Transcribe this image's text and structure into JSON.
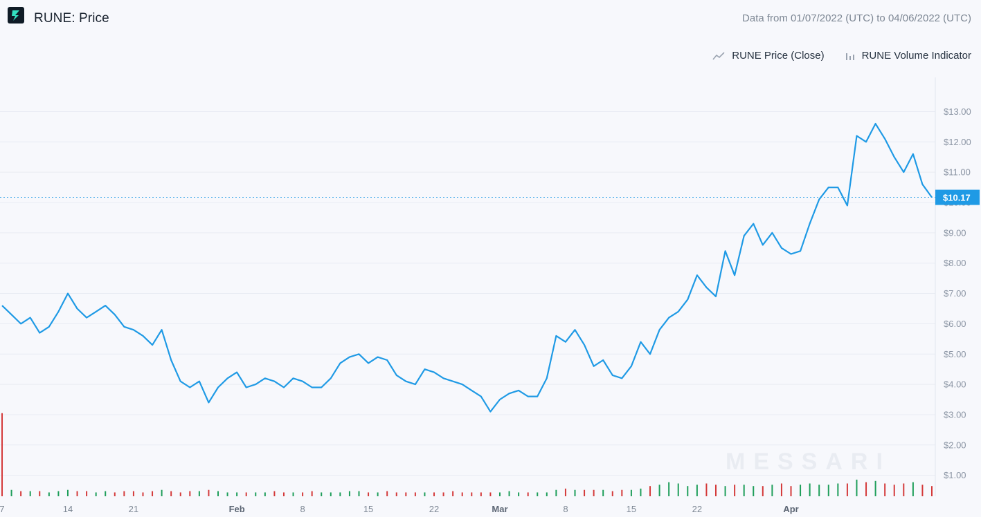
{
  "header": {
    "title": "RUNE: Price",
    "date_range": "Data from 01/07/2022 (UTC) to 04/06/2022 (UTC)",
    "logo_icon": "thorchain-logo-icon"
  },
  "legend": [
    {
      "label": "RUNE Price (Close)",
      "icon": "line-series-icon"
    },
    {
      "label": "RUNE Volume Indicator",
      "icon": "bar-series-icon"
    }
  ],
  "watermark": "MESSARI",
  "colors": {
    "line": "#1f9ae5",
    "last_price_badge": "#1f9ae5",
    "volume_up": "#1e9e5a",
    "volume_down": "#d43a3a",
    "grid": "#e8ebf3",
    "background": "#f7f8fc"
  },
  "chart_data": {
    "type": "line",
    "title": "RUNE: Price",
    "xlabel": "",
    "ylabel": "",
    "ylim": [
      0.3,
      13.5
    ],
    "last_value_label": "$10.17",
    "y_ticks": [
      {
        "value": 1,
        "label": "$1.00"
      },
      {
        "value": 2,
        "label": "$2.00"
      },
      {
        "value": 3,
        "label": "$3.00"
      },
      {
        "value": 4,
        "label": "$4.00"
      },
      {
        "value": 5,
        "label": "$5.00"
      },
      {
        "value": 6,
        "label": "$6.00"
      },
      {
        "value": 7,
        "label": "$7.00"
      },
      {
        "value": 8,
        "label": "$8.00"
      },
      {
        "value": 9,
        "label": "$9.00"
      },
      {
        "value": 10,
        "label": "$10.00"
      },
      {
        "value": 11,
        "label": "$11.00"
      },
      {
        "value": 12,
        "label": "$12.00"
      },
      {
        "value": 13,
        "label": "$13.00"
      }
    ],
    "x_ticks": [
      {
        "day": 0,
        "label": "7"
      },
      {
        "day": 7,
        "label": "14"
      },
      {
        "day": 14,
        "label": "21"
      },
      {
        "day": 25,
        "label": "Feb",
        "month": true
      },
      {
        "day": 32,
        "label": "8"
      },
      {
        "day": 39,
        "label": "15"
      },
      {
        "day": 46,
        "label": "22"
      },
      {
        "day": 53,
        "label": "Mar",
        "month": true
      },
      {
        "day": 60,
        "label": "8"
      },
      {
        "day": 67,
        "label": "15"
      },
      {
        "day": 74,
        "label": "22"
      },
      {
        "day": 84,
        "label": "Apr",
        "month": true
      }
    ],
    "series": [
      {
        "name": "RUNE Price (Close)",
        "x_start": "2022-01-07",
        "values": [
          6.6,
          6.3,
          6.0,
          6.2,
          5.7,
          5.9,
          6.4,
          7.0,
          6.5,
          6.2,
          6.4,
          6.6,
          6.3,
          5.9,
          5.8,
          5.6,
          5.3,
          5.8,
          4.8,
          4.1,
          3.9,
          4.1,
          3.4,
          3.9,
          4.2,
          4.4,
          3.9,
          4.0,
          4.2,
          4.1,
          3.9,
          4.2,
          4.1,
          3.9,
          3.9,
          4.2,
          4.7,
          4.9,
          5.0,
          4.7,
          4.9,
          4.8,
          4.3,
          4.1,
          4.0,
          4.5,
          4.4,
          4.2,
          4.1,
          4.0,
          3.8,
          3.6,
          3.1,
          3.5,
          3.7,
          3.8,
          3.6,
          3.6,
          4.2,
          5.6,
          5.4,
          5.8,
          5.3,
          4.6,
          4.8,
          4.3,
          4.2,
          4.6,
          5.4,
          5.0,
          5.8,
          6.2,
          6.4,
          6.8,
          7.6,
          7.2,
          6.9,
          8.4,
          7.6,
          8.9,
          9.3,
          8.6,
          9.0,
          8.5,
          8.3,
          8.4,
          9.3,
          10.1,
          10.5,
          10.5,
          9.9,
          12.2,
          12.0,
          12.6,
          12.1,
          11.5,
          11.0,
          11.6,
          10.6,
          10.17
        ]
      },
      {
        "name": "RUNE Volume Indicator",
        "values": [
          0.65,
          0.05,
          0.04,
          0.04,
          0.04,
          0.03,
          0.04,
          0.05,
          0.04,
          0.04,
          0.03,
          0.04,
          0.03,
          0.04,
          0.04,
          0.03,
          0.04,
          0.05,
          0.04,
          0.03,
          0.04,
          0.04,
          0.05,
          0.04,
          0.03,
          0.03,
          0.03,
          0.03,
          0.03,
          0.04,
          0.03,
          0.03,
          0.03,
          0.04,
          0.03,
          0.03,
          0.03,
          0.04,
          0.04,
          0.03,
          0.03,
          0.04,
          0.03,
          0.03,
          0.03,
          0.03,
          0.03,
          0.03,
          0.04,
          0.03,
          0.03,
          0.03,
          0.03,
          0.03,
          0.04,
          0.03,
          0.03,
          0.03,
          0.03,
          0.05,
          0.06,
          0.05,
          0.05,
          0.05,
          0.05,
          0.04,
          0.05,
          0.05,
          0.06,
          0.08,
          0.09,
          0.11,
          0.1,
          0.08,
          0.09,
          0.1,
          0.09,
          0.08,
          0.09,
          0.09,
          0.08,
          0.08,
          0.09,
          0.1,
          0.08,
          0.09,
          0.1,
          0.09,
          0.09,
          0.1,
          0.1,
          0.13,
          0.11,
          0.12,
          0.1,
          0.09,
          0.1,
          0.11,
          0.09,
          0.08
        ],
        "directions": [
          "down",
          "up",
          "down",
          "up",
          "down",
          "up",
          "up",
          "up",
          "down",
          "down",
          "up",
          "up",
          "down",
          "down",
          "down",
          "down",
          "down",
          "up",
          "down",
          "down",
          "down",
          "up",
          "down",
          "up",
          "up",
          "up",
          "down",
          "up",
          "up",
          "down",
          "down",
          "up",
          "down",
          "down",
          "up",
          "up",
          "up",
          "up",
          "up",
          "down",
          "up",
          "down",
          "down",
          "down",
          "down",
          "up",
          "down",
          "down",
          "down",
          "down",
          "down",
          "down",
          "down",
          "up",
          "up",
          "up",
          "down",
          "up",
          "up",
          "up",
          "down",
          "up",
          "down",
          "down",
          "up",
          "down",
          "down",
          "up",
          "up",
          "down",
          "up",
          "up",
          "up",
          "up",
          "up",
          "down",
          "down",
          "up",
          "down",
          "up",
          "up",
          "down",
          "up",
          "down",
          "down",
          "up",
          "up",
          "up",
          "up",
          "up",
          "down",
          "up",
          "down",
          "up",
          "down",
          "down",
          "down",
          "up",
          "down",
          "down"
        ]
      }
    ],
    "grid": true,
    "legend_position": "top-right"
  }
}
